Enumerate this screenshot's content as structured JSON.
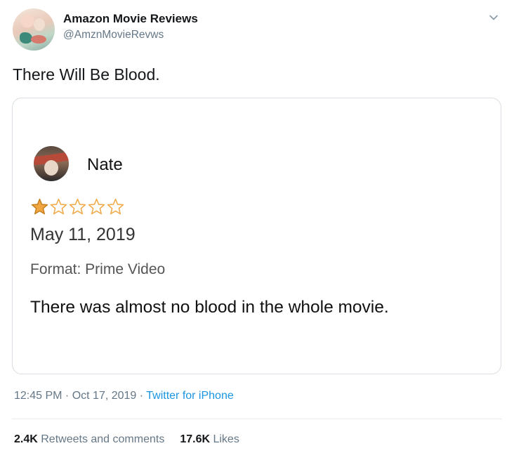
{
  "tweet": {
    "author": {
      "display_name": "Amazon Movie Reviews",
      "handle": "@AmznMovieRevws",
      "avatar_icon": "profile-avatar"
    },
    "menu_icon": "chevron-down-icon",
    "text": "There Will Be Blood.",
    "timestamp": "12:45 PM · Oct 17, 2019 · ",
    "source": "Twitter for iPhone",
    "stats": {
      "retweets_count": "2.4K",
      "retweets_label": " Retweets and comments",
      "likes_count": "17.6K",
      "likes_label": " Likes"
    }
  },
  "review": {
    "reviewer_name": "Nate",
    "rating": 1,
    "rating_max": 5,
    "star_color": "#f0a742",
    "date": "May 11, 2019",
    "format": "Format: Prime Video",
    "body": "There was almost no blood in the whole movie."
  }
}
